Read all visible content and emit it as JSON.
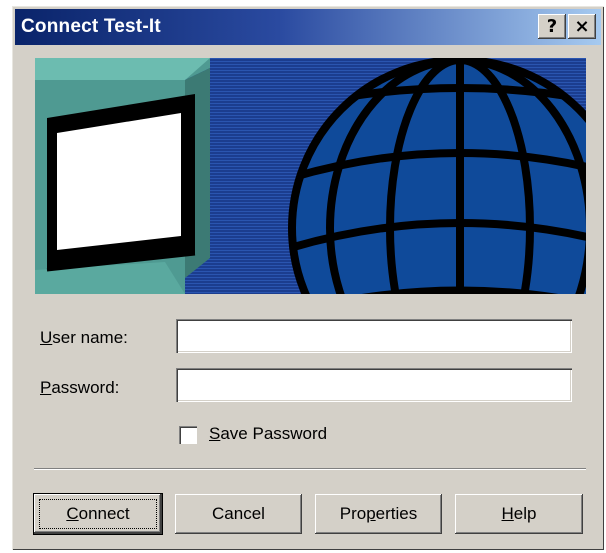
{
  "window": {
    "title": "Connect Test-It",
    "help_button": "?",
    "close_button": "×"
  },
  "form": {
    "username_label": "User name:",
    "username_value": "",
    "password_label": "Password:",
    "password_value": "",
    "save_password_label": "Save Password",
    "save_password_checked": false
  },
  "buttons": {
    "connect": "Connect",
    "cancel": "Cancel",
    "properties": "Properties",
    "help": "Help"
  },
  "colors": {
    "titlebar_start": "#0a246a",
    "banner_background": "#1a3a8c",
    "globe": "#0f4a9a",
    "monitor": "#5eaaa0"
  }
}
